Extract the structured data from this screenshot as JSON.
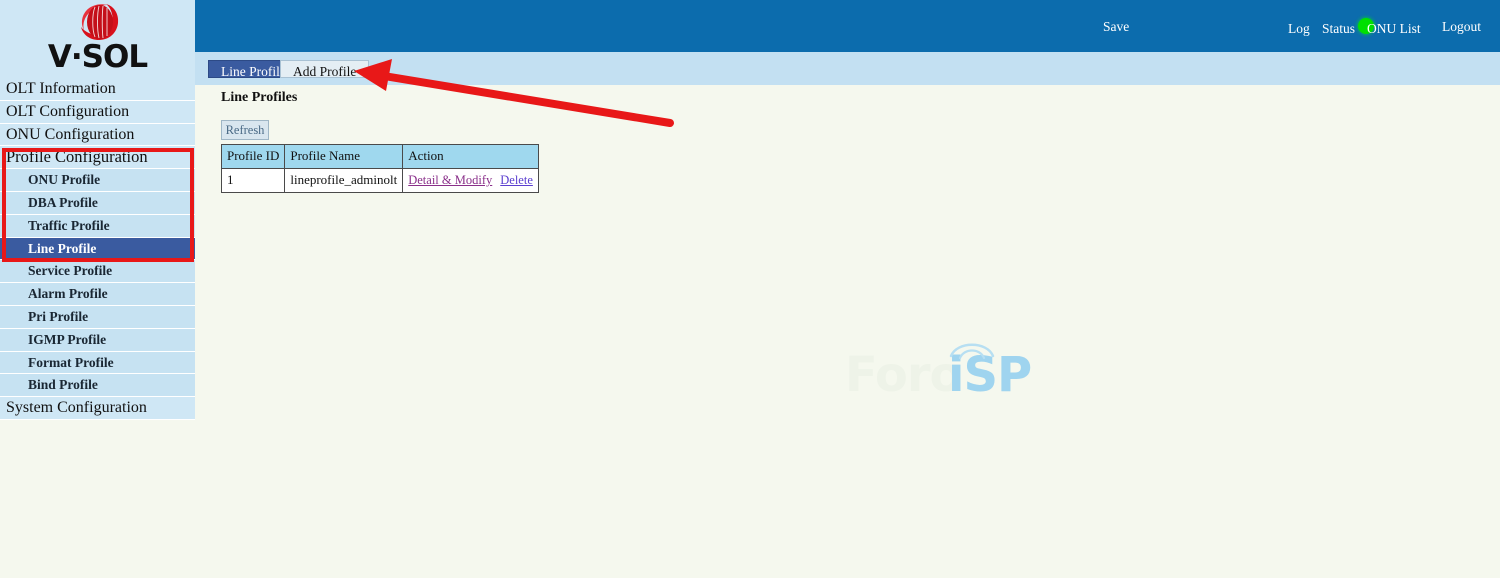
{
  "brand": {
    "logo_icon": "vsol-sphere-logo-icon",
    "wordmark": "V·SOL"
  },
  "header": {
    "save_label": "Save",
    "indicator_icon": "status-green-dot-icon",
    "indicator_color": "#00e000",
    "log_label": "Log",
    "status_label": "Status",
    "onu_list_label": "ONU List",
    "logout_label": "Logout",
    "background_color": "#0c6cad"
  },
  "sidebar": {
    "items": [
      {
        "label": "OLT Information",
        "level": "top",
        "active": false
      },
      {
        "label": "OLT Configuration",
        "level": "top",
        "active": false
      },
      {
        "label": "ONU Configuration",
        "level": "top",
        "active": false
      },
      {
        "label": "Profile Configuration",
        "level": "group",
        "active": false
      },
      {
        "label": "ONU Profile",
        "level": "sub",
        "active": false
      },
      {
        "label": "DBA Profile",
        "level": "sub",
        "active": false
      },
      {
        "label": "Traffic Profile",
        "level": "sub",
        "active": false
      },
      {
        "label": "Line Profile",
        "level": "sub",
        "active": true
      },
      {
        "label": "Service Profile",
        "level": "sub",
        "active": false
      },
      {
        "label": "Alarm Profile",
        "level": "sub",
        "active": false
      },
      {
        "label": "Pri Profile",
        "level": "sub",
        "active": false
      },
      {
        "label": "IGMP Profile",
        "level": "sub",
        "active": false
      },
      {
        "label": "Format Profile",
        "level": "sub",
        "active": false
      },
      {
        "label": "Bind Profile",
        "level": "sub",
        "active": false
      },
      {
        "label": "System Configuration",
        "level": "top",
        "active": false
      }
    ]
  },
  "tabs": [
    {
      "label": "Line Profile",
      "active": true
    },
    {
      "label": "Add Profile",
      "active": false
    }
  ],
  "main": {
    "page_title": "Line Profiles",
    "refresh_label": "Refresh",
    "table": {
      "columns": [
        "Profile ID",
        "Profile Name",
        "Action"
      ],
      "rows": [
        {
          "profile_id": "1",
          "profile_name": "lineprofile_adminolt",
          "detail_label": "Detail & Modify",
          "delete_label": "Delete"
        }
      ]
    }
  },
  "watermark": {
    "text_light": "Foro",
    "text_blue": "iSP",
    "arc_icon": "wifi-signal-arc-icon",
    "blue_color": "#9fd4ef"
  },
  "annotations": {
    "highlight_box_color": "#e81818",
    "arrow_color": "#e81818",
    "arrow_target": "Add Profile",
    "box_target": "Profile Configuration menu group"
  }
}
